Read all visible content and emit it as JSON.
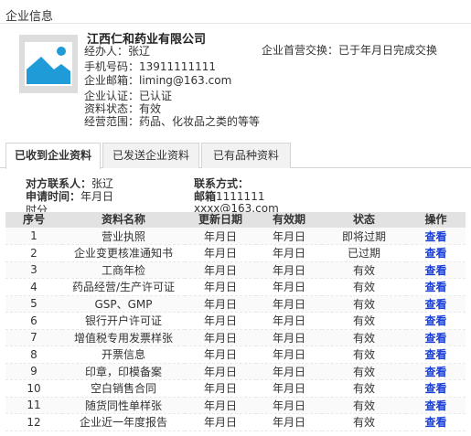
{
  "section_title": "企业信息",
  "company": {
    "name": "江西仁和药业有限公司",
    "lines": [
      "经办人：张辽",
      "手机号码：13911111111",
      "企业邮箱：liming@163.com",
      "企业认证：已认证",
      "资料状态：有效",
      "经营范围：药品、化妆品之类的等等"
    ],
    "exchange_note": "企业首营交换：已于年月日完成交换"
  },
  "tabs": [
    {
      "label": "已收到企业资料",
      "active": true
    },
    {
      "label": "已发送企业资料",
      "active": false
    },
    {
      "label": "已有品种资料",
      "active": false
    }
  ],
  "contact": {
    "person_label": "对方联系人：",
    "person_value": "张辽",
    "time_label": "申请时间：",
    "time_value": "年月日",
    "time_wrap": "时分",
    "method_label": "联系方式：",
    "email_label": "邮箱",
    "email_value": "1111111",
    "email_wrap": "xxxx@163.com"
  },
  "table": {
    "headers": [
      "序号",
      "资料名称",
      "更新日期",
      "有效期",
      "状态",
      "操作"
    ],
    "rows": [
      [
        "1",
        "营业执照",
        "年月日",
        "年月日",
        "即将过期",
        "查看"
      ],
      [
        "2",
        "企业变更核准通知书",
        "年月日",
        "年月日",
        "已过期",
        "查看"
      ],
      [
        "3",
        "工商年检",
        "年月日",
        "年月日",
        "有效",
        "查看"
      ],
      [
        "4",
        "药品经营/生产许可证",
        "年月日",
        "年月日",
        "有效",
        "查看"
      ],
      [
        "5",
        "GSP、GMP",
        "年月日",
        "年月日",
        "有效",
        "查看"
      ],
      [
        "6",
        "银行开户许可证",
        "年月日",
        "年月日",
        "有效",
        "查看"
      ],
      [
        "7",
        "增值税专用发票样张",
        "年月日",
        "年月日",
        "有效",
        "查看"
      ],
      [
        "8",
        "开票信息",
        "年月日",
        "年月日",
        "有效",
        "查看"
      ],
      [
        "9",
        "印章，印模备案",
        "年月日",
        "年月日",
        "有效",
        "查看"
      ],
      [
        "10",
        "空白销售合同",
        "年月日",
        "年月日",
        "有效",
        "查看"
      ],
      [
        "11",
        "随货同性单样张",
        "年月日",
        "年月日",
        "有效",
        "查看"
      ],
      [
        "12",
        "企业近一年度报告",
        "年月日",
        "年月日",
        "有效",
        "查看"
      ]
    ]
  }
}
